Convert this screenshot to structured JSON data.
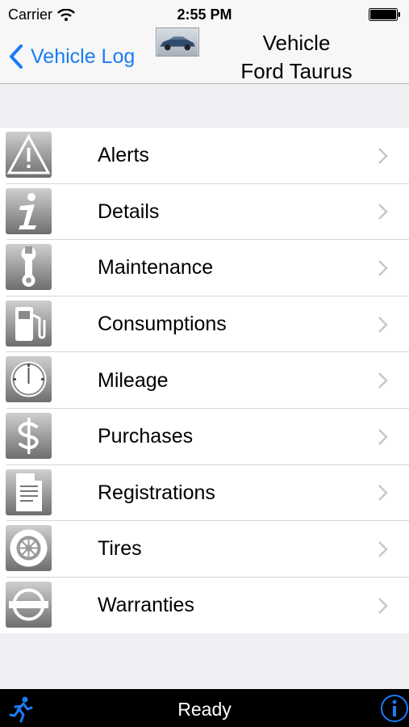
{
  "status_bar": {
    "carrier": "Carrier",
    "time": "2:55 PM"
  },
  "nav": {
    "back_label": "Vehicle Log",
    "title_line1": "Vehicle",
    "title_line2": "Ford Taurus",
    "accent_color": "#1a7cf5"
  },
  "menu": [
    {
      "label": "Alerts",
      "icon": "alert-triangle-icon"
    },
    {
      "label": "Details",
      "icon": "info-icon"
    },
    {
      "label": "Maintenance",
      "icon": "wrench-icon"
    },
    {
      "label": "Consumptions",
      "icon": "fuel-pump-icon"
    },
    {
      "label": "Mileage",
      "icon": "odometer-icon"
    },
    {
      "label": "Purchases",
      "icon": "dollar-icon"
    },
    {
      "label": "Registrations",
      "icon": "document-icon"
    },
    {
      "label": "Tires",
      "icon": "tire-icon"
    },
    {
      "label": "Warranties",
      "icon": "warranty-badge-icon"
    }
  ],
  "bottom_bar": {
    "status": "Ready"
  }
}
